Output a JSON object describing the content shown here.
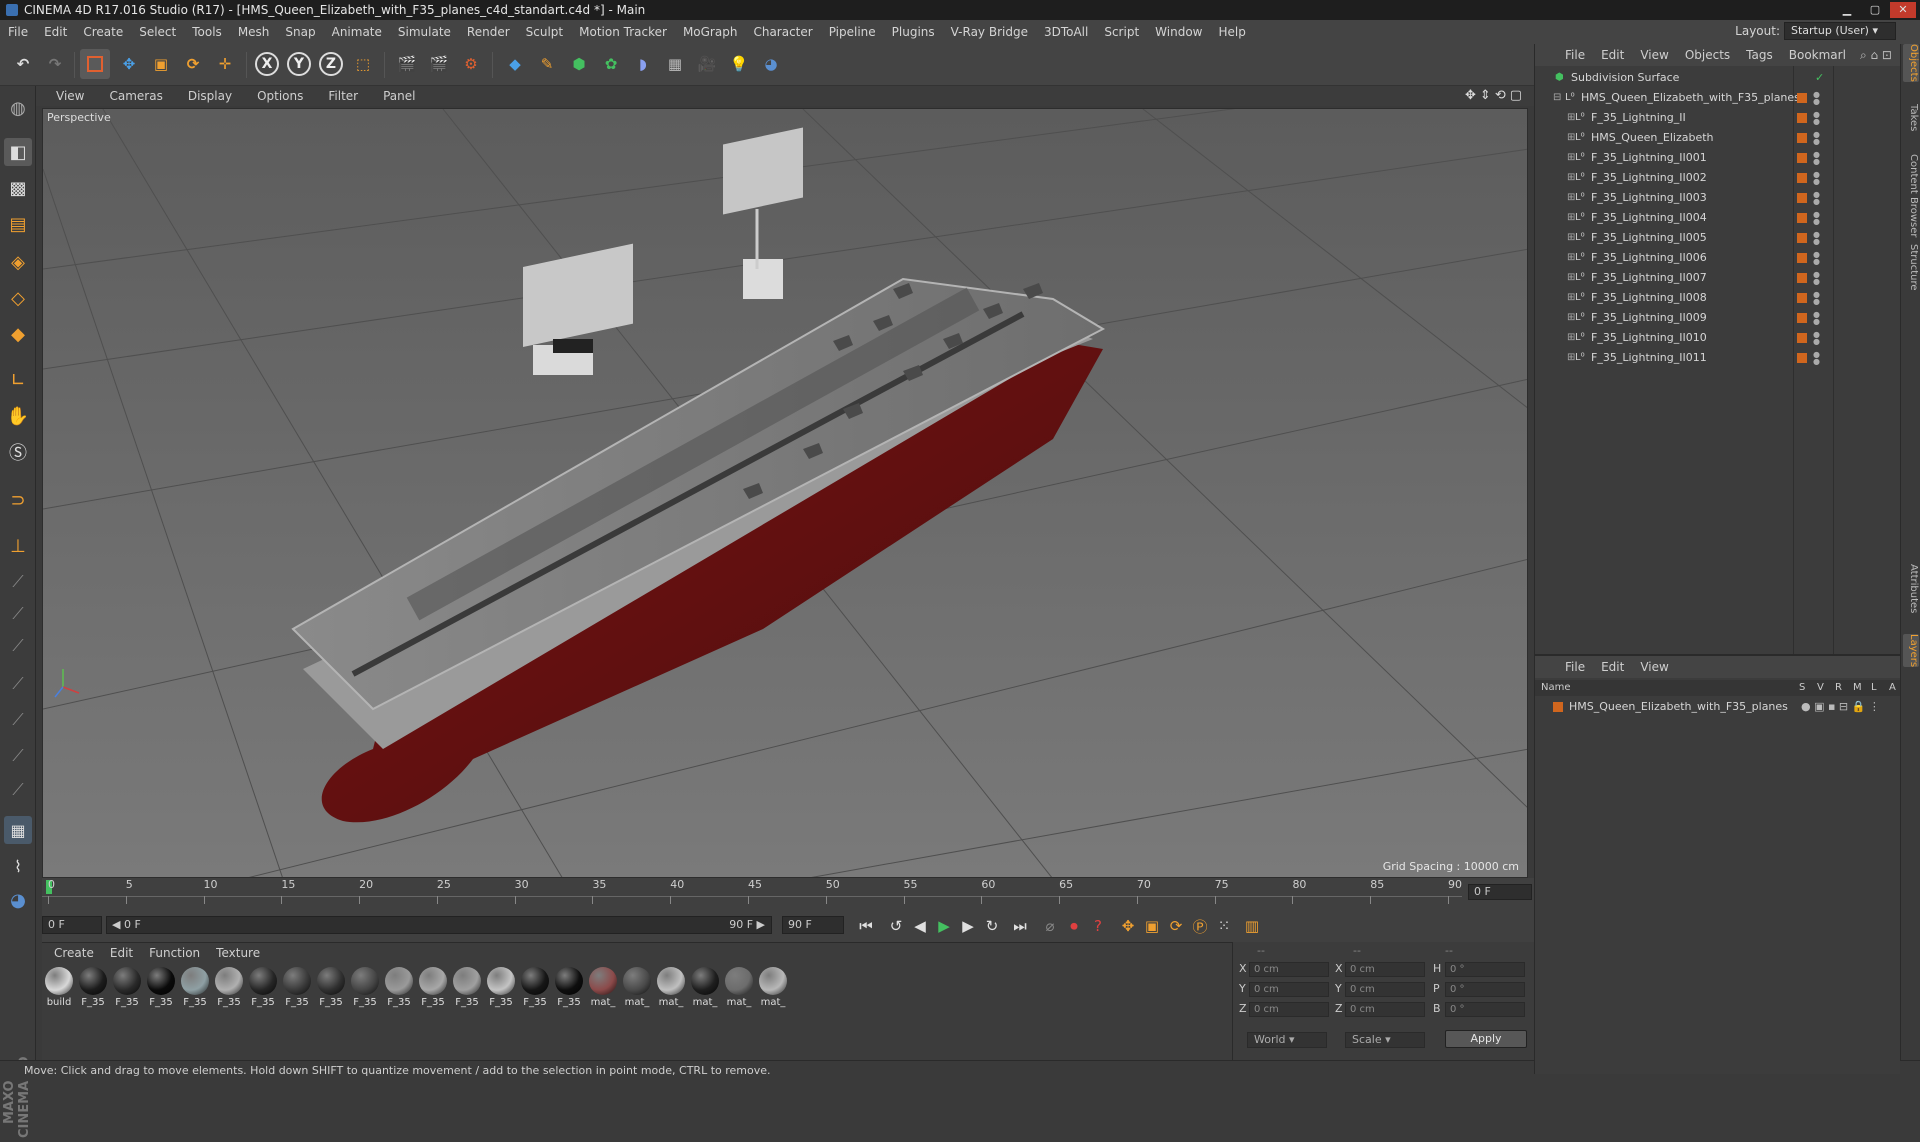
{
  "window": {
    "title": "CINEMA 4D R17.016 Studio (R17) - [HMS_Queen_Elizabeth_with_F35_planes_c4d_standart.c4d *] - Main",
    "min_glyph": "▁",
    "max_glyph": "▢",
    "close_glyph": "✕"
  },
  "menubar": {
    "items": [
      "File",
      "Edit",
      "Create",
      "Select",
      "Tools",
      "Mesh",
      "Snap",
      "Animate",
      "Simulate",
      "Render",
      "Sculpt",
      "Motion Tracker",
      "MoGraph",
      "Character",
      "Pipeline",
      "Plugins",
      "V-Ray Bridge",
      "3DToAll",
      "Script",
      "Window",
      "Help"
    ],
    "layout_label": "Layout:",
    "layout_value": "Startup (User)"
  },
  "toolbar": {
    "axis_x": "X",
    "axis_y": "Y",
    "axis_z": "Z"
  },
  "viewport": {
    "menu": [
      "View",
      "Cameras",
      "Display",
      "Options",
      "Filter",
      "Panel"
    ],
    "label": "Perspective",
    "grid_spacing": "Grid Spacing : 10000 cm",
    "nav_icons": "✥⇕⟲▢"
  },
  "timeline": {
    "ticks": [
      "0",
      "5",
      "10",
      "15",
      "20",
      "25",
      "30",
      "35",
      "40",
      "45",
      "50",
      "55",
      "60",
      "65",
      "70",
      "75",
      "80",
      "85",
      "90"
    ],
    "current_frame": "0 F"
  },
  "transport": {
    "start": "0 F",
    "range_start": "◀ 0 F",
    "range_end": "90 F ▶",
    "end": "90 F"
  },
  "materials": {
    "menu": [
      "Create",
      "Edit",
      "Function",
      "Texture"
    ],
    "items": [
      {
        "label": "build",
        "color": "#d8d8d8"
      },
      {
        "label": "F_35",
        "color": "#1c1c1c"
      },
      {
        "label": "F_35",
        "color": "#2a2a2a"
      },
      {
        "label": "F_35",
        "color": "#0a0a0a"
      },
      {
        "label": "F_35",
        "color": "#8fa0a4"
      },
      {
        "label": "F_35",
        "color": "#b0b0b0"
      },
      {
        "label": "F_35",
        "color": "#262626"
      },
      {
        "label": "F_35",
        "color": "#3a3a3a"
      },
      {
        "label": "F_35",
        "color": "#303030"
      },
      {
        "label": "F_35",
        "color": "#454545"
      },
      {
        "label": "F_35",
        "color": "#9a9a9a"
      },
      {
        "label": "F_35",
        "color": "#a8a8a8"
      },
      {
        "label": "F_35",
        "color": "#a0a0a0"
      },
      {
        "label": "F_35",
        "color": "#c4c4c4"
      },
      {
        "label": "F_35",
        "color": "#161616"
      },
      {
        "label": "F_35",
        "color": "#0e0e0e"
      },
      {
        "label": "mat_",
        "color": "#8c4a4a"
      },
      {
        "label": "mat_",
        "color": "#4a4a4a"
      },
      {
        "label": "mat_",
        "color": "#c0c0c0"
      },
      {
        "label": "mat_",
        "color": "#1e1e1e"
      },
      {
        "label": "mat_",
        "color": "#6c6c6c"
      },
      {
        "label": "mat_",
        "color": "#b8b8b8"
      }
    ]
  },
  "coords": {
    "header": [
      "--",
      "--",
      "--"
    ],
    "rows": [
      {
        "l1": "X",
        "v1": "0 cm",
        "l2": "X",
        "v2": "0 cm",
        "l3": "H",
        "v3": "0 °"
      },
      {
        "l1": "Y",
        "v1": "0 cm",
        "l2": "Y",
        "v2": "0 cm",
        "l3": "P",
        "v3": "0 °"
      },
      {
        "l1": "Z",
        "v1": "0 cm",
        "l2": "Z",
        "v2": "0 cm",
        "l3": "B",
        "v3": "0 °"
      }
    ],
    "world": "World",
    "scale": "Scale",
    "apply": "Apply"
  },
  "objects": {
    "menu": [
      "File",
      "Edit",
      "View",
      "Objects",
      "Tags",
      "Bookmarl"
    ],
    "tree": [
      {
        "name": "Subdivision Surface",
        "indent": 0,
        "kind": "subdiv"
      },
      {
        "name": "HMS_Queen_Elizabeth_with_F35_planes",
        "indent": 1,
        "kind": "null"
      },
      {
        "name": "F_35_Lightning_II",
        "indent": 2,
        "kind": "null"
      },
      {
        "name": "HMS_Queen_Elizabeth",
        "indent": 2,
        "kind": "null"
      },
      {
        "name": "F_35_Lightning_II001",
        "indent": 2,
        "kind": "null"
      },
      {
        "name": "F_35_Lightning_II002",
        "indent": 2,
        "kind": "null"
      },
      {
        "name": "F_35_Lightning_II003",
        "indent": 2,
        "kind": "null"
      },
      {
        "name": "F_35_Lightning_II004",
        "indent": 2,
        "kind": "null"
      },
      {
        "name": "F_35_Lightning_II005",
        "indent": 2,
        "kind": "null"
      },
      {
        "name": "F_35_Lightning_II006",
        "indent": 2,
        "kind": "null"
      },
      {
        "name": "F_35_Lightning_II007",
        "indent": 2,
        "kind": "null"
      },
      {
        "name": "F_35_Lightning_II008",
        "indent": 2,
        "kind": "null"
      },
      {
        "name": "F_35_Lightning_II009",
        "indent": 2,
        "kind": "null"
      },
      {
        "name": "F_35_Lightning_II010",
        "indent": 2,
        "kind": "null"
      },
      {
        "name": "F_35_Lightning_II011",
        "indent": 2,
        "kind": "null"
      }
    ]
  },
  "layers": {
    "menu": [
      "File",
      "Edit",
      "View"
    ],
    "columns": [
      "Name",
      "S",
      "V",
      "R",
      "M",
      "L",
      "A"
    ],
    "row": "HMS_Queen_Elizabeth_with_F35_planes"
  },
  "right_tabs": [
    "Objects",
    "Takes",
    "Content Browser",
    "Structure",
    "Attributes",
    "Layers"
  ],
  "status": "Move: Click and drag to move elements. Hold down SHIFT to quantize movement / add to the selection in point mode, CTRL to remove.",
  "brand": "MAXON CINEMA 4D"
}
